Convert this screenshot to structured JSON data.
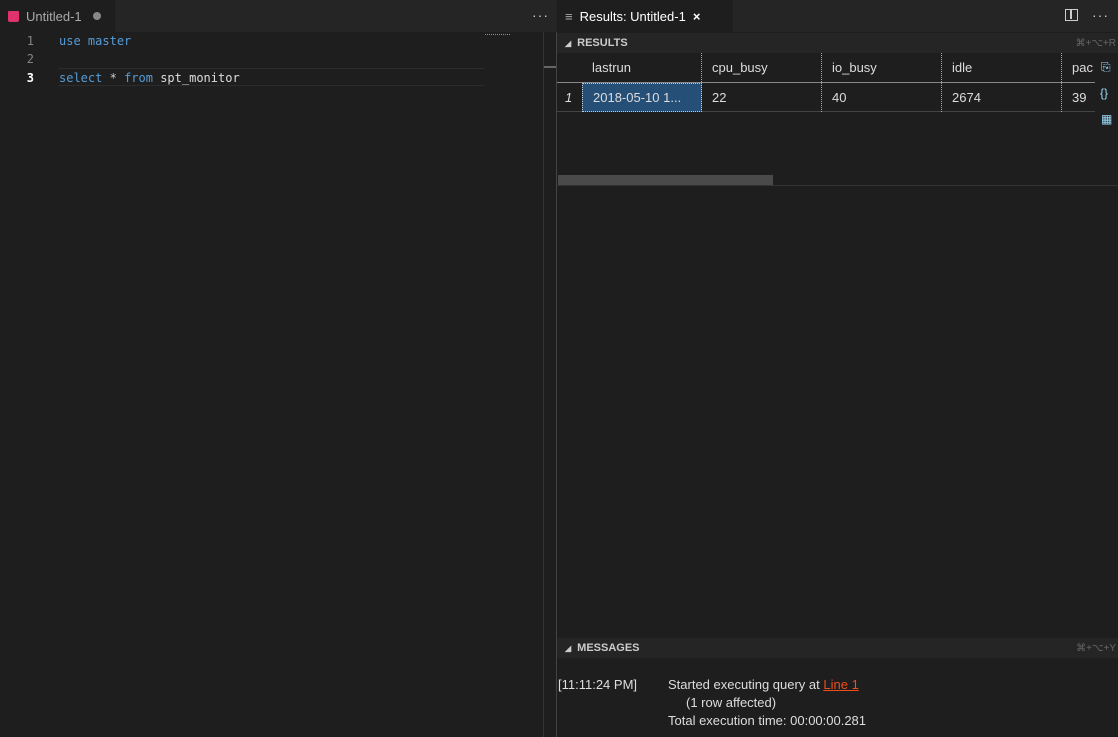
{
  "editor": {
    "tab_title": "Untitled-1",
    "lines": [
      {
        "num": "1",
        "tokens": [
          "use",
          "master"
        ]
      },
      {
        "num": "2"
      },
      {
        "num": "3",
        "tokens": [
          "select",
          "*",
          "from",
          "spt_monitor"
        ]
      }
    ],
    "more": "···"
  },
  "results_tab": {
    "title": "Results: Untitled-1",
    "close": "×",
    "more": "···"
  },
  "results": {
    "header": "RESULTS",
    "shortcut": "⌘+⌥+R",
    "columns": [
      "lastrun",
      "cpu_busy",
      "io_busy",
      "idle",
      "pac"
    ],
    "rows": [
      {
        "num": "1",
        "cells": [
          "2018-05-10 1...",
          "22",
          "40",
          "2674",
          "39"
        ]
      }
    ]
  },
  "messages": {
    "header": "MESSAGES",
    "shortcut": "⌘+⌥+Y",
    "time": "[11:11:24 PM]",
    "line1_prefix": "Started executing query at ",
    "link": "Line 1",
    "line2": "(1 row affected)",
    "line3": "Total execution time: 00:00:00.281"
  },
  "colors": {
    "accent": "#e0336e",
    "selection": "#264f78",
    "link": "#f14c1c"
  }
}
